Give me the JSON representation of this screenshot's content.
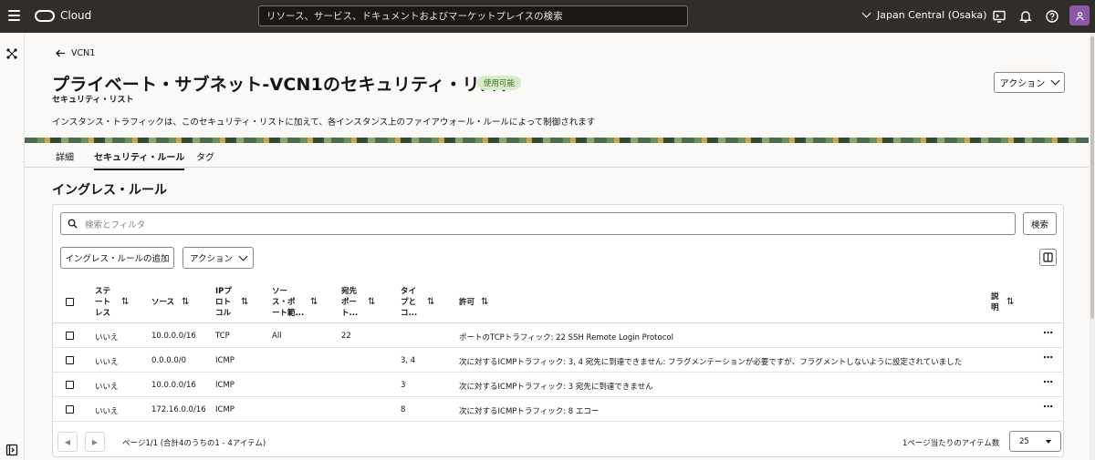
{
  "topbar": {
    "brand": "Cloud",
    "search_placeholder": "リソース、サービス、ドキュメントおよびマーケットプレイスの検索",
    "region": "Japan Central (Osaka)"
  },
  "header": {
    "back_label": "VCN1",
    "title": "プライベート・サブネット-VCN1のセキュリティ・リスト",
    "badge": "使用可能",
    "subtitle": "セキュリティ・リスト",
    "actions_label": "アクション",
    "description": "インスタンス・トラフィックは、このセキュリティ・リストに加えて、各インスタンス上のファイアウォール・ルールによって制御されます"
  },
  "tabs": [
    "詳細",
    "セキュリティ・ルール",
    "タグ"
  ],
  "section_title": "イングレス・ルール",
  "toolbar": {
    "filter_placeholder": "検索とフィルタ",
    "search_label": "検索",
    "add_label": "イングレス・ルールの追加",
    "actions_label": "アクション"
  },
  "table": {
    "headers": {
      "stateless": [
        "ステ",
        "ート",
        "レス"
      ],
      "source": [
        "ソース"
      ],
      "ip_protocol": [
        "IPプ",
        "ロト",
        "コル"
      ],
      "source_port": [
        "ソー",
        "ス・ポ",
        "ート範..."
      ],
      "dest_port": [
        "宛先",
        "ポー",
        "ト..."
      ],
      "type_code": [
        "タイ",
        "プと",
        "コ..."
      ],
      "allows": [
        "許可"
      ],
      "description": [
        "説",
        "明"
      ]
    },
    "rows": [
      {
        "stateless": "いいえ",
        "source": "10.0.0.0/16",
        "protocol": "TCP",
        "source_port": "All",
        "dest_port": "22",
        "type_code": "",
        "allows": "ポートのTCPトラフィック: 22 SSH Remote Login Protocol"
      },
      {
        "stateless": "いいえ",
        "source": "0.0.0.0/0",
        "protocol": "ICMP",
        "source_port": "",
        "dest_port": "",
        "type_code": "3, 4",
        "allows": "次に対するICMPトラフィック: 3, 4 宛先に到達できません: フラグメンテーションが必要ですが、フラグメントしないように設定されていました"
      },
      {
        "stateless": "いいえ",
        "source": "10.0.0.0/16",
        "protocol": "ICMP",
        "source_port": "",
        "dest_port": "",
        "type_code": "3",
        "allows": "次に対するICMPトラフィック: 3 宛先に到達できません"
      },
      {
        "stateless": "いいえ",
        "source": "172.16.0.0/16",
        "protocol": "ICMP",
        "source_port": "",
        "dest_port": "",
        "type_code": "8",
        "allows": "次に対するICMPトラフィック: 8 エコー"
      }
    ]
  },
  "pagination": {
    "info": "ページ1/1 (合計4のうちの1 - 4アイテム)",
    "per_page_label": "1ページ当たりのアイテム数",
    "per_page_value": "25"
  },
  "colors": {
    "topbar": "#312d2a",
    "badge_bg": "#d7ecc8",
    "badge_text": "#3b6d1f",
    "avatar": "#8a5aa6"
  }
}
